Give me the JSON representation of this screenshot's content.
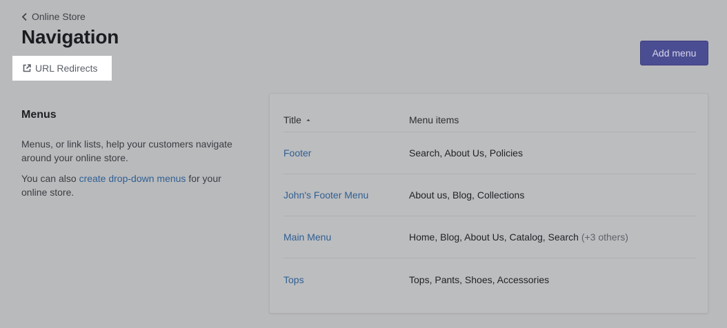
{
  "header": {
    "breadcrumb": "Online Store",
    "title": "Navigation",
    "redirects_label": "URL Redirects",
    "add_menu_label": "Add menu"
  },
  "menus_section": {
    "heading": "Menus",
    "desc1": "Menus, or link lists, help your customers navigate around your online store.",
    "desc2_pre": "You can also ",
    "desc2_link": "create drop-down menus",
    "desc2_post": " for your online store."
  },
  "table": {
    "col_title": "Title",
    "col_items": "Menu items",
    "rows": [
      {
        "title": "Footer",
        "items": "Search, About Us, Policies",
        "others": ""
      },
      {
        "title": "John's Footer Menu",
        "items": "About us, Blog, Collections",
        "others": ""
      },
      {
        "title": "Main Menu",
        "items": "Home, Blog, About Us, Catalog, Search",
        "others": "(+3 others)"
      },
      {
        "title": "Tops",
        "items": "Tops, Pants, Shoes, Accessories",
        "others": ""
      }
    ]
  },
  "icons": {
    "back": "chevron-left-icon",
    "external": "external-link-icon",
    "sort": "sort-ascending-icon"
  },
  "colors": {
    "accent": "#4b4d93",
    "link": "#2f5f93",
    "overlay_bg": "#b9babc"
  }
}
